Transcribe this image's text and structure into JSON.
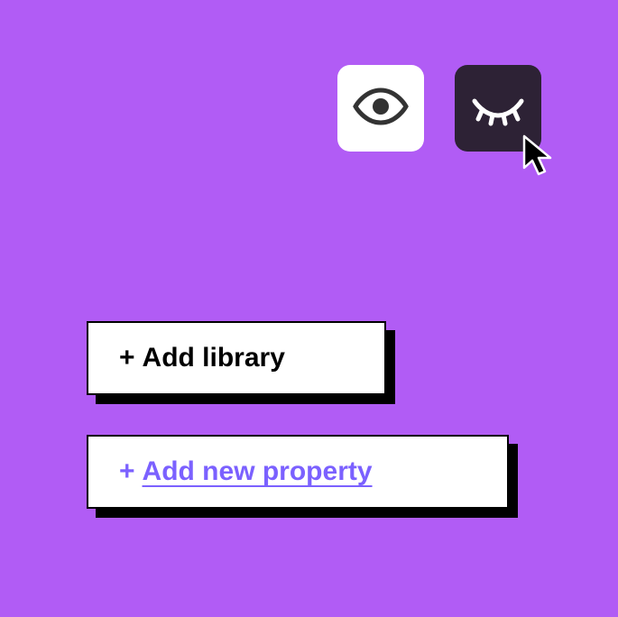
{
  "icons": {
    "eye_open": "eye-open-icon",
    "eye_closed": "eye-closed-icon"
  },
  "buttons": {
    "add_library": {
      "prefix": "+",
      "label": "Add library"
    },
    "add_property": {
      "prefix": "+",
      "label": "Add new property"
    }
  },
  "colors": {
    "background": "#b15cf5",
    "tile_dark": "#2d2235",
    "accent_link": "#7b61ff"
  }
}
